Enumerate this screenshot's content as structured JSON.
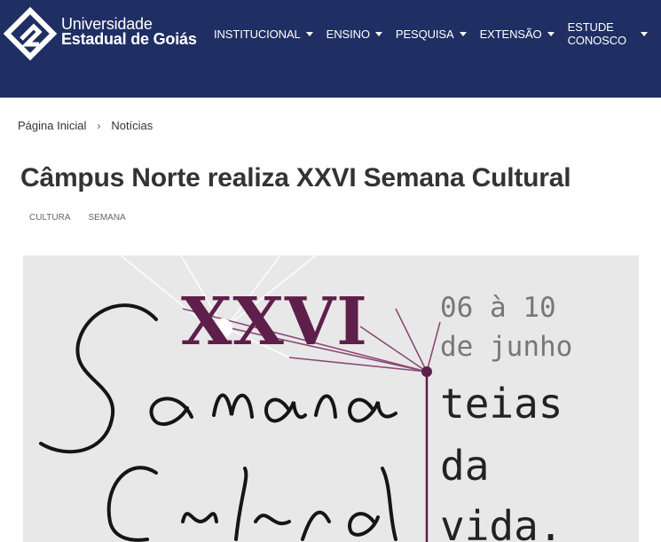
{
  "header": {
    "brand_line1": "Universidade",
    "brand_line2": "Estadual de Goiás",
    "nav": [
      {
        "label": "INSTITUCIONAL"
      },
      {
        "label": "ENSINO"
      },
      {
        "label": "PESQUISA"
      },
      {
        "label": "EXTENSÃO"
      },
      {
        "label": "ESTUDE CONOSCO"
      }
    ],
    "colors": {
      "background": "#1f2f63",
      "text": "#ffffff"
    }
  },
  "breadcrumb": {
    "home": "Página Inicial",
    "separator": "›",
    "current": "Notícias"
  },
  "article": {
    "title": "Câmpus Norte realiza XXVI Semana Cultural",
    "tags": [
      "CULTURA",
      "SEMANA"
    ]
  },
  "poster": {
    "edition": "XXVI",
    "dates_line1": "06 à 10",
    "dates_line2": "de junho",
    "theme_words": [
      "teias",
      "da",
      "vida."
    ],
    "script_title": "Semana Cultural",
    "colors": {
      "accent": "#5e1f4a",
      "background": "#e9e8e8"
    }
  }
}
